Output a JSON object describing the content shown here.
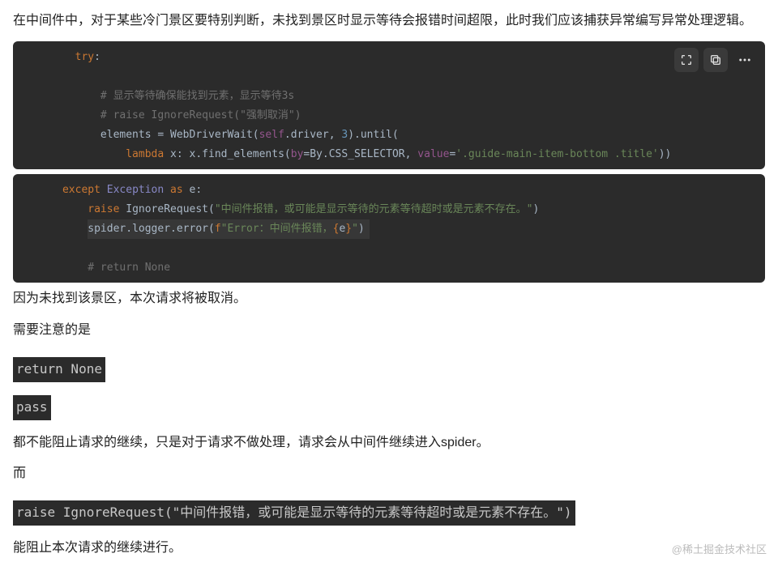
{
  "para_intro": "在中间件中，对于某些冷门景区要特别判断，未找到景区时显示等待会报错时间超限，此时我们应该捕获异常编写异常处理逻辑。",
  "code1": {
    "l1_try": "try",
    "l2_cmt": "# 显示等待确保能找到元素，显示等待3s",
    "l3_cmt": "# raise IgnoreRequest(\"强制取消\")",
    "l4_id_elements": "elements",
    "l4_eq": " = ",
    "l4_wdw": "WebDriverWait",
    "l4_lp": "(",
    "l4_self": "self",
    "l4_dot_driver": ".driver",
    "l4_comma": ", ",
    "l4_num": "3",
    "l4_rp": ")",
    "l4_until": ".until(",
    "l5_lambda": "lambda",
    "l5_x": " x: x.find_elements(",
    "l5_by_kw": "by",
    "l5_eq": "=",
    "l5_by_val": "By.CSS_SELECTOR",
    "l5_comma": ", ",
    "l5_val_kw": "value",
    "l5_eq2": "=",
    "l5_str": "'.guide-main-item-bottom .title'",
    "l5_close": "))"
  },
  "code2": {
    "l1_except": "except",
    "l1_sp": " ",
    "l1_exc": "Exception",
    "l1_as": " as ",
    "l1_e": "e",
    "l1_colon": ":",
    "l2_raise": "raise",
    "l2_sp": " ",
    "l2_ign": "IgnoreRequest",
    "l2_lp": "(",
    "l2_str": "\"中间件报错，或可能是显示等待的元素等待超时或是元素不存在。\"",
    "l2_rp": ")",
    "l3_spd": "spider.logger.error(",
    "l3_f": "f",
    "l3_str1": "\"Error：中间件报错，",
    "l3_brace_o": "{",
    "l3_e": "e",
    "l3_brace_c": "}",
    "l3_str2": "\"",
    "l3_rp": ")",
    "l5_cmt": "# return None"
  },
  "para_after1": "因为未找到该景区，本次请求将被取消。",
  "para_after2": "需要注意的是",
  "inline_return": "return None",
  "inline_pass": "pass",
  "para_after3": "都不能阻止请求的继续，只是对于请求不做处理，请求会从中间件继续进入spider。",
  "para_after4": "而",
  "inline_raise": "raise IgnoreRequest(\"中间件报错，或可能是显示等待的元素等待超时或是元素不存在。\")",
  "para_after5": "能阻止本次请求的继续进行。",
  "watermark": "@稀土掘金技术社区"
}
